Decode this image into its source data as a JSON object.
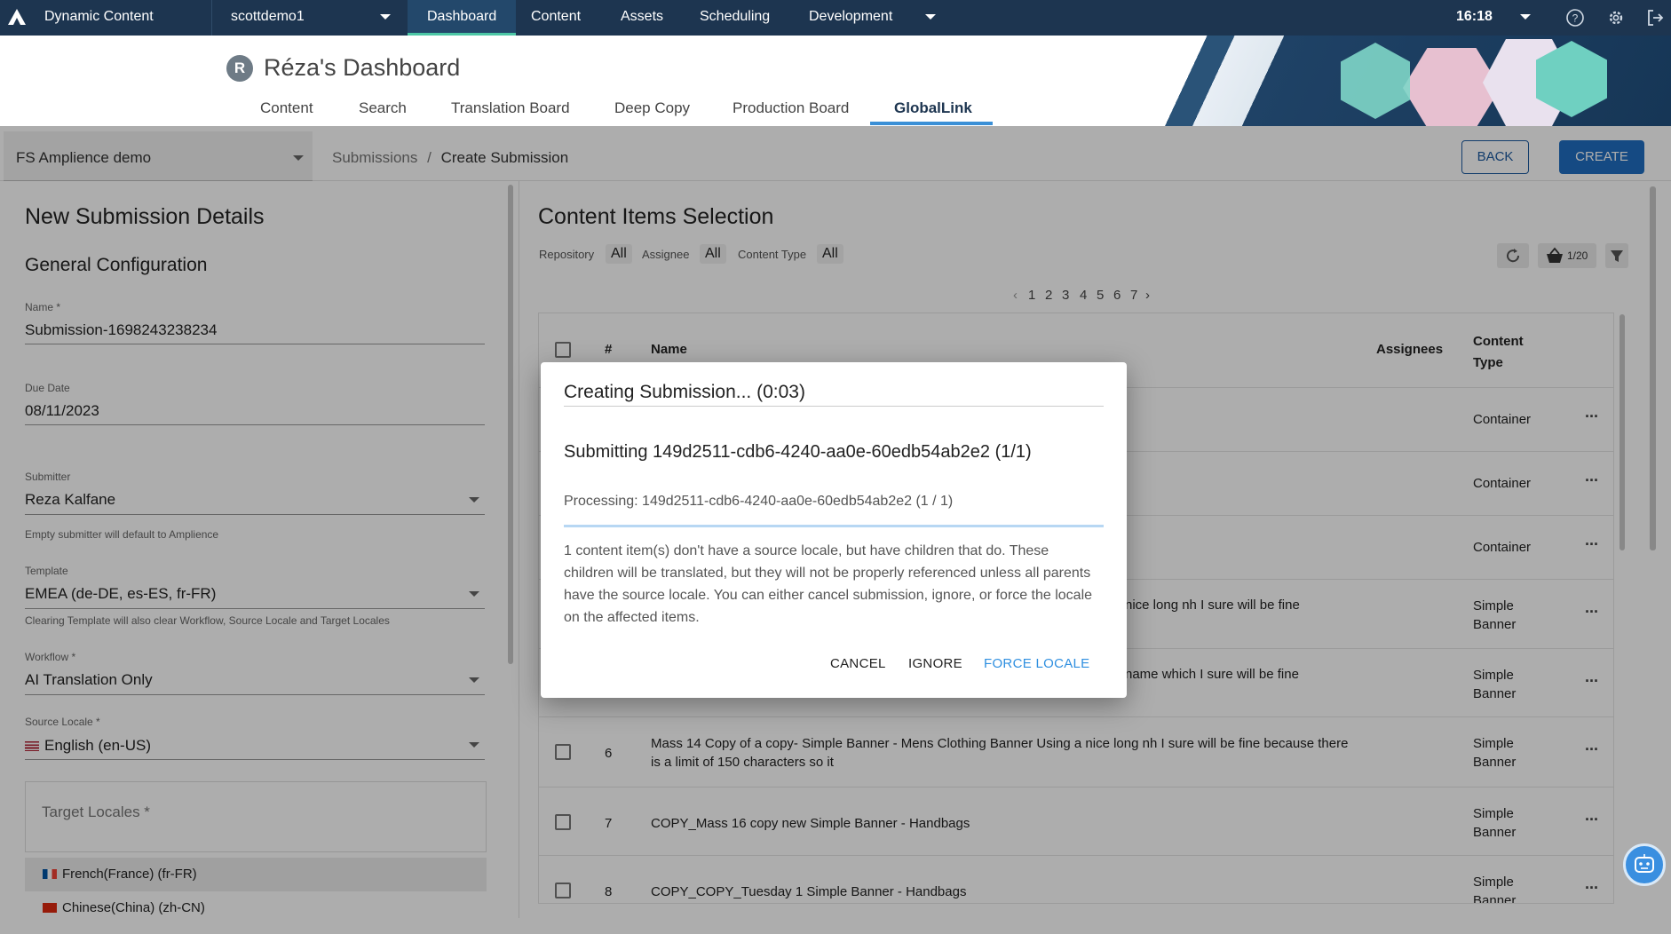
{
  "topbar": {
    "app_name": "Dynamic Content",
    "hub": "scottdemo1",
    "nav": [
      "Dashboard",
      "Content",
      "Assets",
      "Scheduling",
      "Development"
    ],
    "time": "16:18"
  },
  "dashboard": {
    "avatar_letter": "R",
    "title": "Réza's Dashboard",
    "tabs": [
      "Content",
      "Search",
      "Translation Board",
      "Deep Copy",
      "Production Board",
      "GlobalLink"
    ],
    "active_tab": "GlobalLink"
  },
  "toolbar": {
    "repository": "FS Amplience demo",
    "breadcrumb_parent": "Submissions",
    "breadcrumb_sep": "/",
    "breadcrumb_current": "Create Submission",
    "back_label": "BACK",
    "create_label": "CREATE"
  },
  "left": {
    "title": "New Submission Details",
    "section": "General Configuration",
    "name_label": "Name *",
    "name_value": "Submission-1698243238234",
    "due_label": "Due Date",
    "due_value": "08/11/2023",
    "submitter_label": "Submitter",
    "submitter_value": "Reza Kalfane",
    "submitter_help": "Empty submitter will default to Amplience",
    "template_label": "Template",
    "template_value": "EMEA (de-DE, es-ES, fr-FR)",
    "template_help": "Clearing Template will also clear Workflow, Source Locale and Target Locales",
    "workflow_label": "Workflow *",
    "workflow_value": "AI Translation Only",
    "source_label": "Source Locale *",
    "source_value": "English (en-US)",
    "target_label": "Target Locales *",
    "target_items": [
      "French(France) (fr-FR)",
      "Chinese(China) (zh-CN)"
    ]
  },
  "right": {
    "title": "Content Items Selection",
    "filters": [
      {
        "label": "Repository",
        "value": "All"
      },
      {
        "label": "Assignee",
        "value": "All"
      },
      {
        "label": "Content Type",
        "value": "All"
      }
    ],
    "basket_count": "1/20",
    "pages": [
      "1",
      "2",
      "3",
      "4",
      "5",
      "6",
      "7"
    ],
    "current_page": "1",
    "columns": [
      "#",
      "Name",
      "Assignees",
      "Content Type"
    ],
    "rows": [
      {
        "num": "",
        "name": "",
        "type": "Container"
      },
      {
        "num": "",
        "name": "",
        "type": "Container"
      },
      {
        "num": "",
        "name": "",
        "type": "Container"
      },
      {
        "num": "",
        "name": "nice long nh I sure will be fine",
        "type": "Simple Banner"
      },
      {
        "num": "",
        "name": "name which I sure will be fine",
        "type": "Simple Banner"
      },
      {
        "num": "6",
        "name": "Mass 14 Copy of a copy- Simple Banner - Mens Clothing Banner Using a nice long nh I sure will be fine because there is a limit of 150 characters so it",
        "type": "Simple Banner"
      },
      {
        "num": "7",
        "name": "COPY_Mass 16 copy new Simple Banner - Handbags",
        "type": "Simple Banner"
      },
      {
        "num": "8",
        "name": "COPY_COPY_Tuesday 1 Simple Banner - Handbags",
        "type": "Simple Banner"
      }
    ]
  },
  "modal": {
    "title": "Creating Submission... (0:03)",
    "subtitle": "Submitting 149d2511-cdb6-4240-aa0e-60edb54ab2e2 (1/1)",
    "processing": "Processing: 149d2511-cdb6-4240-aa0e-60edb54ab2e2 (1 / 1)",
    "progress": 1.0,
    "message": "1 content item(s) don't have a source locale, but have children that do. These children will be translated, but they will not be properly referenced unless all parents have the source locale. You can either cancel submission, ignore, or force the locale on the affected items.",
    "cancel": "CANCEL",
    "ignore": "IGNORE",
    "force": "FORCE LOCALE"
  },
  "colors": {
    "topbar": "#1d3550",
    "accent": "#1f6ec1",
    "tab_underline": "#3a8fd6",
    "force_link": "#2f8fe0"
  }
}
